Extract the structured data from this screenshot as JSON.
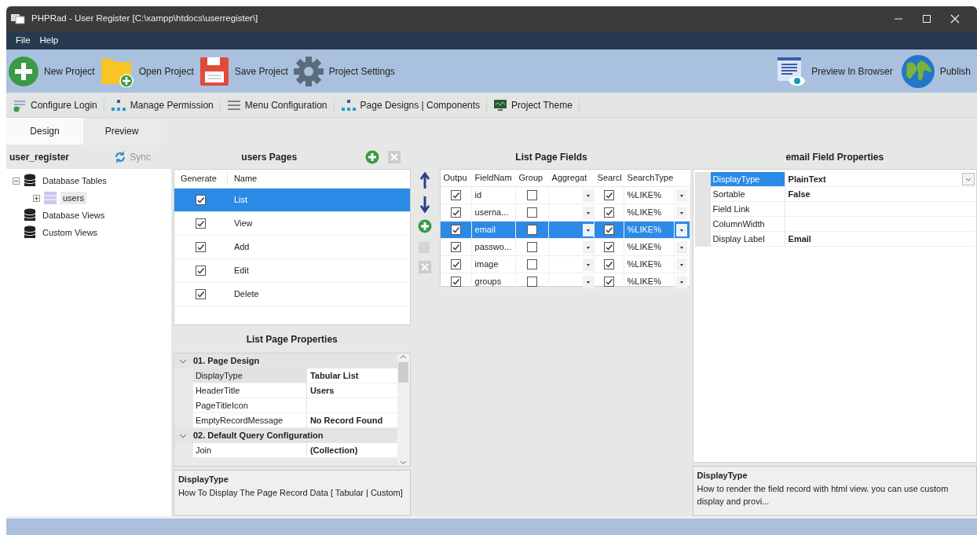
{
  "window": {
    "title": "PHPRad - User Register [C:\\xampp\\htdocs\\userregister\\]"
  },
  "menu": [
    "File",
    "Help"
  ],
  "main_toolbar": {
    "left": [
      {
        "label": "New Project",
        "kind": "new"
      },
      {
        "label": "Open Project",
        "kind": "open"
      },
      {
        "label": "Save Project",
        "kind": "save"
      },
      {
        "label": "Project Settings",
        "kind": "settings"
      }
    ],
    "right": [
      {
        "label": "Preview In Browser",
        "kind": "preview"
      },
      {
        "label": "Publish",
        "kind": "publish"
      }
    ]
  },
  "secondary_toolbar": [
    {
      "label": "Configure Login",
      "kind": "login"
    },
    {
      "label": "Manage Permission",
      "kind": "hierarchy"
    },
    {
      "label": "Menu Configuration",
      "kind": "menu"
    },
    {
      "label": "Page Designs | Components",
      "kind": "hierarchy"
    },
    {
      "label": "Project Theme",
      "kind": "monitor"
    }
  ],
  "tabs": [
    {
      "label": "Design",
      "selected": true
    },
    {
      "label": "Preview",
      "selected": false
    }
  ],
  "project_panel": {
    "title": "user_register",
    "sync_label": "Sync",
    "tree": [
      {
        "label": "Database Tables",
        "kind": "database",
        "expanded": true,
        "selected": false,
        "children": [
          {
            "label": "users",
            "kind": "table",
            "expanded": false,
            "selected": true
          }
        ]
      },
      {
        "label": "Database Views",
        "kind": "database",
        "selected": false
      },
      {
        "label": "Custom Views",
        "kind": "database",
        "selected": false
      }
    ]
  },
  "pages_panel": {
    "title": "users Pages",
    "columns": [
      "Generate",
      "Name"
    ],
    "rows": [
      {
        "generate": true,
        "name": "List",
        "selected": true
      },
      {
        "generate": true,
        "name": "View",
        "selected": false
      },
      {
        "generate": true,
        "name": "Add",
        "selected": false
      },
      {
        "generate": true,
        "name": "Edit",
        "selected": false
      },
      {
        "generate": true,
        "name": "Delete",
        "selected": false
      }
    ]
  },
  "list_page_properties": {
    "title": "List Page Properties",
    "groups": [
      {
        "title": "01. Page Design",
        "expanded": true,
        "properties": [
          {
            "name": "DisplayType",
            "value": "Tabular List",
            "selected": true
          },
          {
            "name": "HeaderTitle",
            "value": "Users",
            "selected": false
          },
          {
            "name": "PageTitleIcon",
            "selected": false
          },
          {
            "name": "EmptyRecordMessage",
            "value": "No Record Found",
            "selected": false
          }
        ]
      },
      {
        "title": "02. Default Query Configuration",
        "expanded": true,
        "properties": [
          {
            "name": "Join",
            "value": "(Collection)",
            "selected": false
          }
        ]
      }
    ],
    "description": {
      "title": "DisplayType",
      "text": "How To Display The Page Record Data [ Tabular | Custom]"
    }
  },
  "fields_panel": {
    "title": "List Page Fields",
    "columns": [
      "Outpu",
      "FieldNam",
      "Group",
      "Aggregat",
      "Searcl",
      "SearchType"
    ],
    "rows": [
      {
        "output": true,
        "field_name": "id",
        "group": false,
        "search": true,
        "search_type": "%LIKE%",
        "selected": false
      },
      {
        "output": true,
        "field_name": "userna...",
        "group": false,
        "search": true,
        "search_type": "%LIKE%",
        "selected": false
      },
      {
        "output": true,
        "field_name": "email",
        "group": false,
        "search": true,
        "search_type": "%LIKE%",
        "selected": true
      },
      {
        "output": true,
        "field_name": "passwo...",
        "group": false,
        "search": true,
        "search_type": "%LIKE%",
        "selected": false
      },
      {
        "output": true,
        "field_name": "image",
        "group": false,
        "search": true,
        "search_type": "%LIKE%",
        "selected": false
      },
      {
        "output": true,
        "field_name": "groups",
        "group": false,
        "search": true,
        "search_type": "%LIKE%",
        "selected": false
      }
    ]
  },
  "field_properties": {
    "title": "email Field Properties",
    "properties": [
      {
        "name": "DisplayType",
        "value": "PlainText",
        "selected": true
      },
      {
        "name": "Sortable",
        "value": "False",
        "selected": false
      },
      {
        "name": "Field Link",
        "selected": false
      },
      {
        "name": "ColumnWidth",
        "selected": false
      },
      {
        "name": "Display Label",
        "value": "Email",
        "selected": false
      }
    ],
    "description": {
      "title": "DisplayType",
      "text": "How to render the field record with html view. you can use custom display and provi..."
    }
  }
}
